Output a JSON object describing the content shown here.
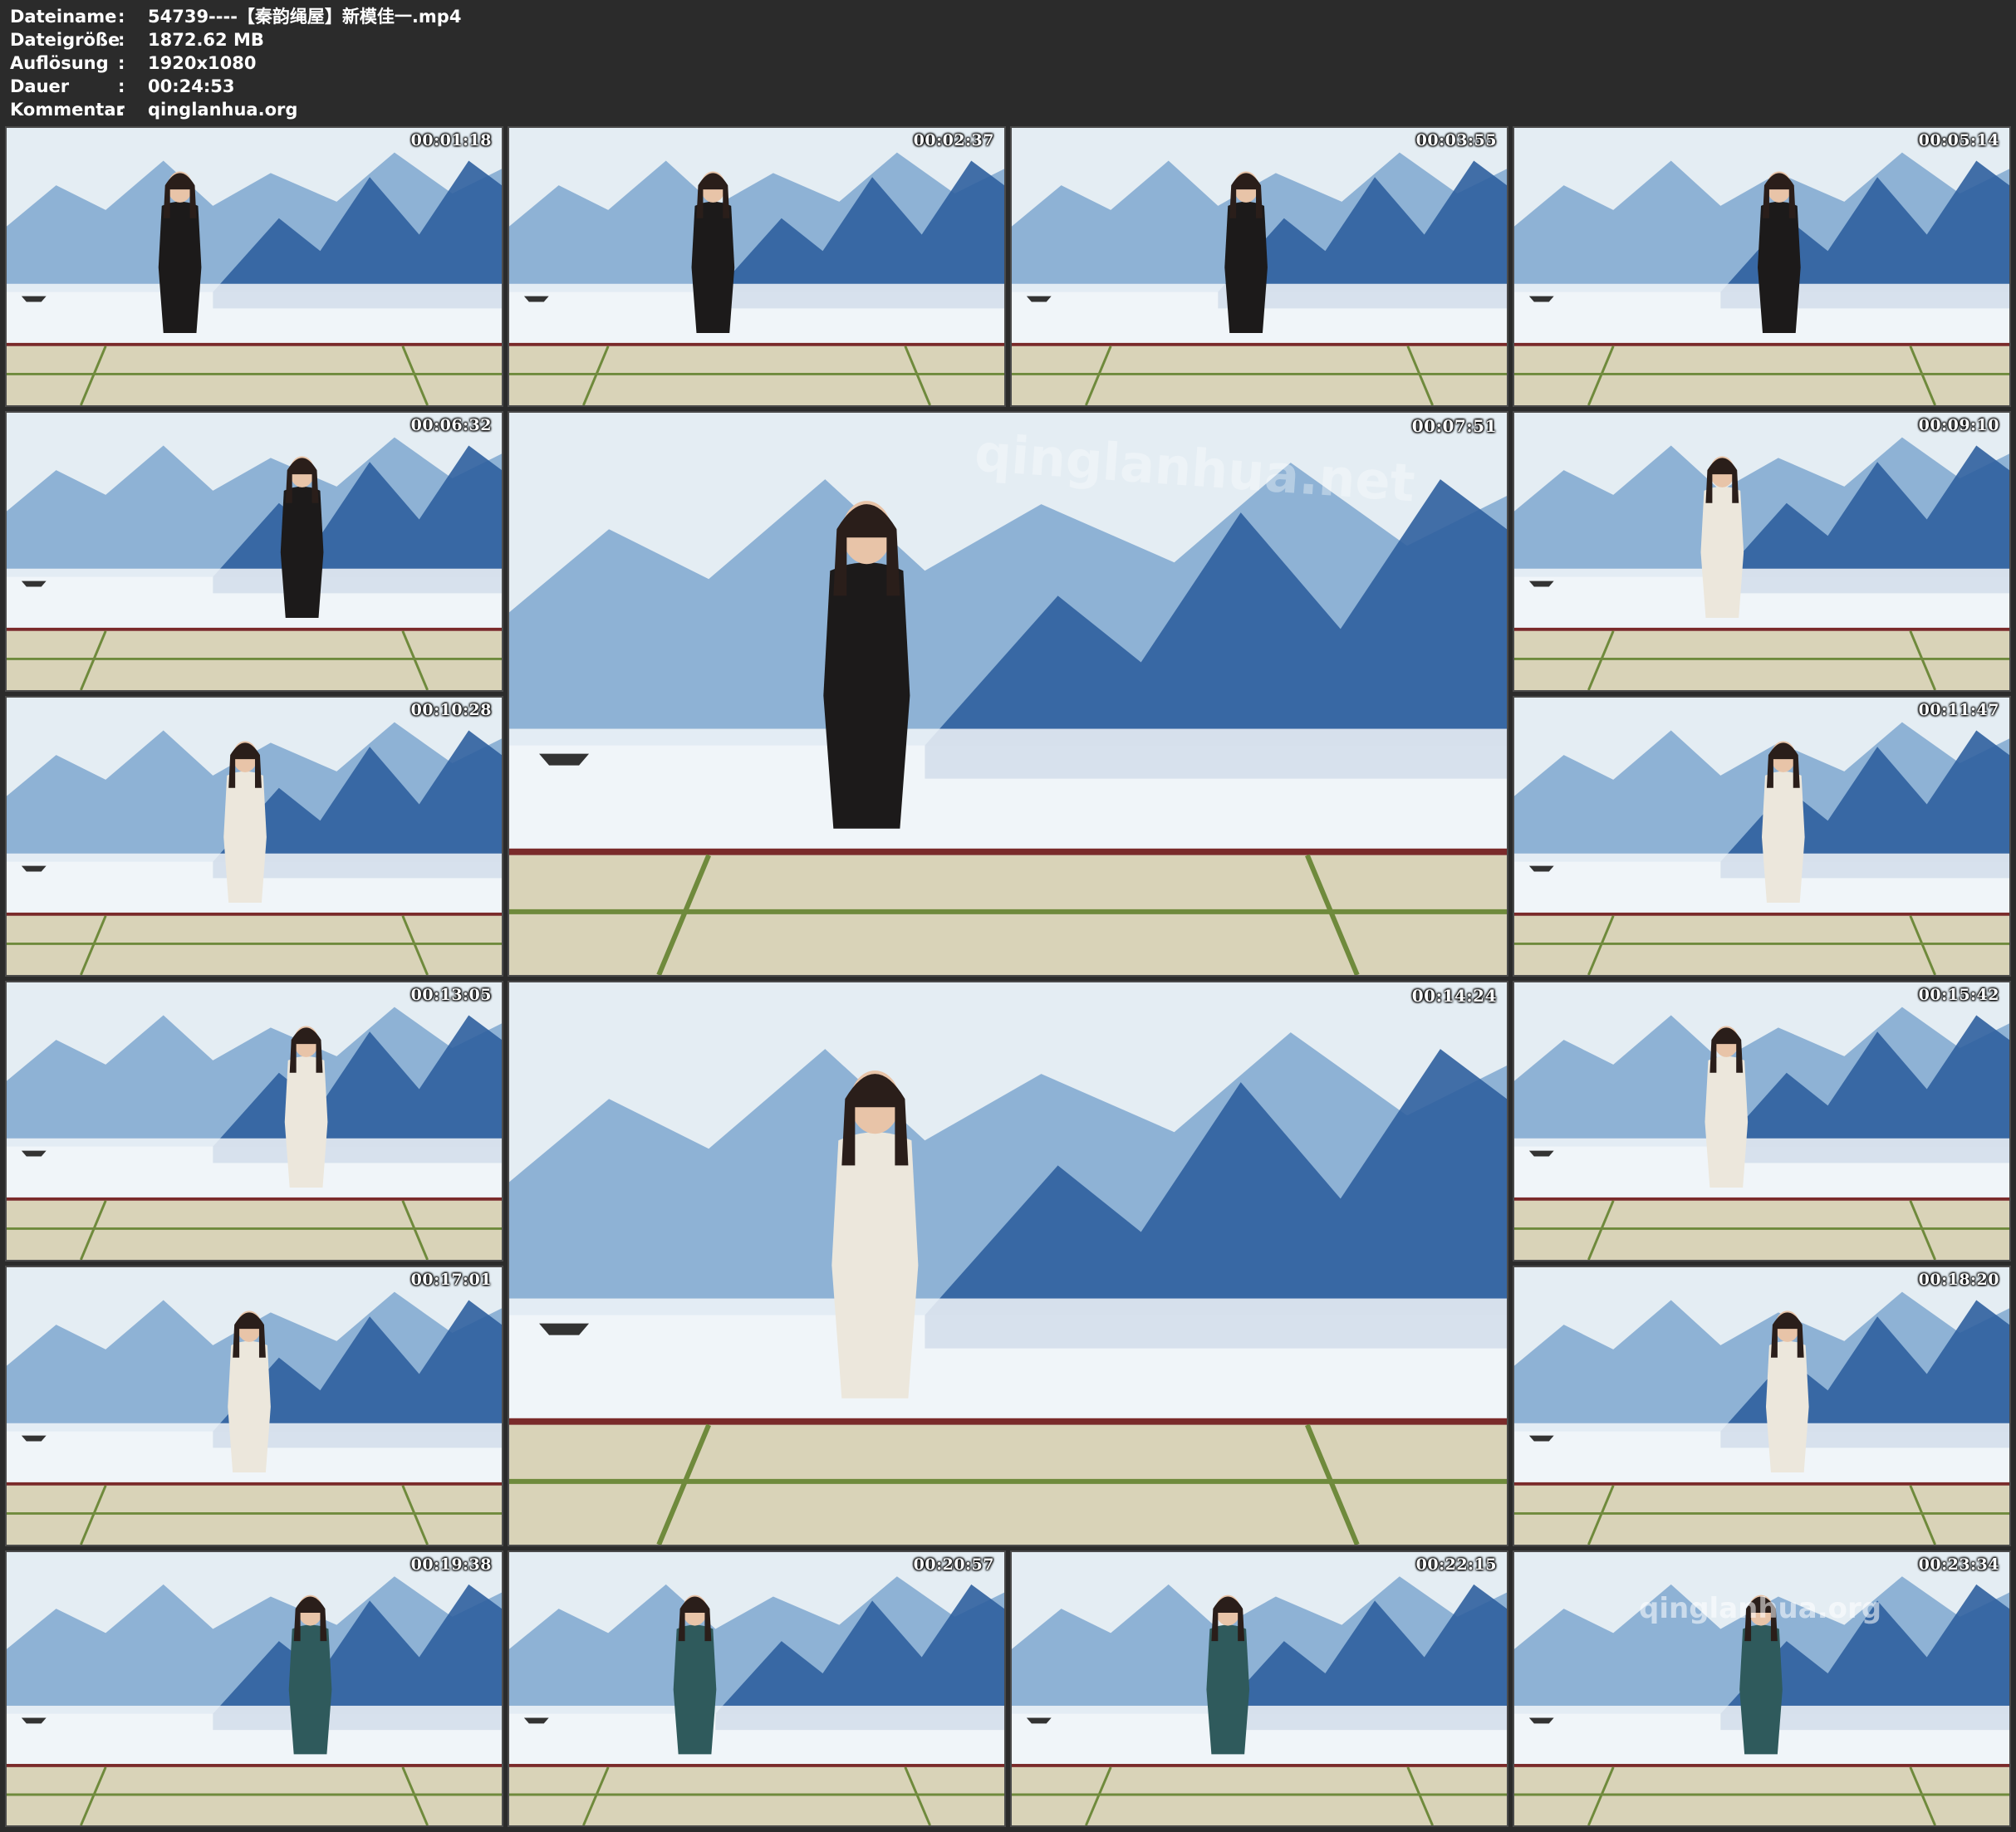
{
  "info": {
    "rows": [
      {
        "key": "Dateiname",
        "sep": ":",
        "value": "54739----【秦韵绳屋】新模佳一.mp4"
      },
      {
        "key": "Dateigröße",
        "sep": ":",
        "value": "1872.62 MB"
      },
      {
        "key": "Auflösung",
        "sep": ":",
        "value": "1920x1080"
      },
      {
        "key": "Dauer",
        "sep": ":",
        "value": "00:24:53"
      },
      {
        "key": "Kommentar",
        "sep": ":",
        "value": "qinglanhua.org"
      }
    ]
  },
  "thumbnails": [
    {
      "timestamp": "00:01:18",
      "dress": "black"
    },
    {
      "timestamp": "00:02:37",
      "dress": "black"
    },
    {
      "timestamp": "00:03:55",
      "dress": "black"
    },
    {
      "timestamp": "00:05:14",
      "dress": "black"
    },
    {
      "timestamp": "00:06:32",
      "dress": "black"
    },
    {
      "timestamp": "00:07:51",
      "dress": "black"
    },
    {
      "timestamp": "00:09:10",
      "dress": "white"
    },
    {
      "timestamp": "00:10:28",
      "dress": "white"
    },
    {
      "timestamp": "00:11:47",
      "dress": "white"
    },
    {
      "timestamp": "00:13:05",
      "dress": "white"
    },
    {
      "timestamp": "00:14:24",
      "dress": "white"
    },
    {
      "timestamp": "00:15:42",
      "dress": "white"
    },
    {
      "timestamp": "00:17:01",
      "dress": "white"
    },
    {
      "timestamp": "00:18:20",
      "dress": "white"
    },
    {
      "timestamp": "00:19:38",
      "dress": "teal"
    },
    {
      "timestamp": "00:20:57",
      "dress": "teal"
    },
    {
      "timestamp": "00:22:15",
      "dress": "teal"
    },
    {
      "timestamp": "00:23:34",
      "dress": "teal"
    }
  ],
  "watermarks": {
    "large": "qinglanhua.net",
    "corner": "qinglanhua.org"
  },
  "colors": {
    "background": "#2b2b2b",
    "text": "#ffffff",
    "sky": "#e4edf3",
    "mountain_dark": "#2f5f9e",
    "mountain_light": "#7fa7cf",
    "floor": "#d9d3b8",
    "floor_line": "#6f8a3c"
  }
}
